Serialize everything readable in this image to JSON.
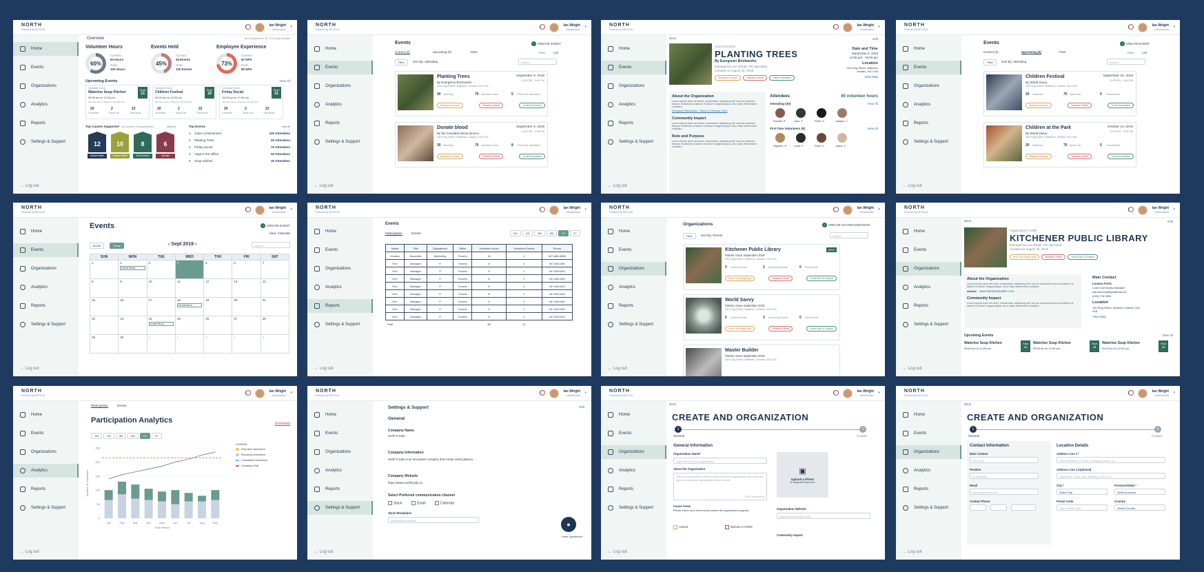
{
  "brand": {
    "logo": "NORTH",
    "sub": "Powered by NFOCUS"
  },
  "user": {
    "name": "Ian Wright",
    "role": "Administrator"
  },
  "nav": {
    "home": "Home",
    "events": "Events",
    "organizations": "Organizations",
    "analytics": "Analytics",
    "reports": "Reports",
    "settings": "Settings & Support",
    "logout": "Log out"
  },
  "common": {
    "back": "Back",
    "edit": "Edit",
    "view_all": "View All",
    "create_event": "CREATE EVENT",
    "filter": "Filter",
    "search": "Search",
    "upload_photo": "Upload a Photo",
    "upload_hint": "or Drag and Drop here"
  },
  "tags": {
    "marginal": "Marginal Groups",
    "disaster": "Disaster Relief",
    "youth": "Youth Education"
  },
  "dashboard": {
    "overview": "Overview",
    "as_of": "As of September 10, 2019 (last update)",
    "kpis": [
      {
        "title": "Volunteer Hours",
        "pct": "60%",
        "pct_label": "Achieved",
        "l1": "Current",
        "v1": "60 Hours",
        "l2": "Goal",
        "v2": "100 Hours",
        "color": "#6a7a8a"
      },
      {
        "title": "Events Held",
        "pct": "45%",
        "pct_label": "Achieved",
        "l1": "Current",
        "v1": "45 Events",
        "l2": "Goal",
        "v2": "100 Events",
        "color": "#c07a7a"
      },
      {
        "title": "Employee Experience",
        "pct": "73%",
        "pct_label": "Achieved",
        "l1": "Current",
        "v1": "62 NPS",
        "l2": "Goal",
        "v2": "85 NPS",
        "color": "#e06a5a"
      }
    ],
    "upcoming_title": "Upcoming Events",
    "upcoming": [
      {
        "type": "Volunteer Event",
        "name": "Waterloo Soup Kitchen",
        "time": "09:00 am to 12:00 pm",
        "addr": "150 King Street, Waterloo, ON N2L 3G1",
        "month": "Sept",
        "day": "13",
        "c1": "20",
        "c2": "2",
        "c3": "22"
      },
      {
        "type": "Volunteer Event",
        "name": "Children Festival",
        "time": "09:00 am to 12:00 pm",
        "addr": "150 King Street, Waterloo, ON N2L 3G1",
        "month": "Sept",
        "day": "18",
        "c1": "20",
        "c2": "2",
        "c3": "22"
      },
      {
        "type": "Corporate Event",
        "name": "Friday Social",
        "time": "15:00 pm to 17:00 pm",
        "addr": "150 King Street, Waterloo, ON N2L 3G1",
        "month": "Sept",
        "day": "21",
        "c1": "20",
        "c2": "2",
        "c3": "22"
      }
    ],
    "count_labels": [
      "Confirmed",
      "Spots Left",
      "Total Spots"
    ],
    "causes_title": "Top Causes Supported",
    "causes_sub": "(by Number of Organizations)",
    "causes": [
      {
        "n": "12",
        "label": "Mental Health",
        "color": "#243b5a"
      },
      {
        "n": "10",
        "label": "Disaster Relief",
        "color": "#9aa23a"
      },
      {
        "n": "8",
        "label": "Environment",
        "color": "#2f6a5a"
      },
      {
        "n": "6",
        "label": "Animals",
        "color": "#8a3b4b"
      }
    ],
    "top_events_title": "Top Events",
    "top_events": [
      {
        "name": "Junior Achievement",
        "v": "100 Attendees"
      },
      {
        "name": "Planting Trees",
        "v": "60 Attendees"
      },
      {
        "name": "Friday Social",
        "v": "70 Attendees"
      },
      {
        "name": "Yoga in the Office",
        "v": "50 Attendees"
      },
      {
        "name": "Soup Kitchen",
        "v": "40 Attendees"
      }
    ]
  },
  "events_list": {
    "title": "Events",
    "tabs": [
      "Current (2)",
      "Upcoming (0)",
      "Past"
    ],
    "sort": "Sort By: Attending",
    "view": "View:",
    "view_mode": "List",
    "items": [
      {
        "name": "Planting Trees",
        "by": "By Evergreen Brickworks",
        "addr": "150 King Street, Waterloo, Ontario, N2J 2X6",
        "date": "September 9, 2019",
        "time": "12:00 PM - 3:00 PM",
        "a": "30",
        "h": "70",
        "f": "5"
      },
      {
        "name": "Donate blood",
        "by": "By the Canadian blood service",
        "addr": "150 King Street, Waterloo, Ontario, N2J 2X6",
        "date": "September 9, 2019",
        "time": "12:00 PM - 3:00 PM",
        "a": "30",
        "h": "70",
        "f": "8"
      }
    ],
    "labels": [
      "Attending",
      "Volunteer hours",
      "First Time Volunteers"
    ]
  },
  "event_detail": {
    "current": "Current Events",
    "name": "PLANTING TREES",
    "by": "By Evergreen Brickworks",
    "managed": "Managed by Ian Wright, HR Specialist",
    "created": "Created on August 30, 2019",
    "date_label": "Date and Time",
    "date": "September 9, 2019",
    "time": "12:00 pm - 03:00 pm",
    "loc_label": "Location",
    "loc": "150 King Street, Waterloo Ontario, N2J 2X6",
    "map": "View Map",
    "about": "About the Organization",
    "lorem": "Lorem ipsum dolor sit amet, consectetur adipiscing elit, sed do eiusmod tempor incididunt ut labore et dolore magna aliqua. Arcu vitae elementum curabitur.",
    "waiver": "Evergreen Brickworks - Waiver & Release Form",
    "impact": "Community Impact",
    "role": "Role and Purpose",
    "attendees": "Attendees",
    "vol_hours": "60 volunteer hours",
    "attending": "Attending (30)",
    "first_time": "First time Volunteers (5)",
    "people": [
      "Rosalia. R",
      "Juan. P",
      "Peter. O",
      "Joaquin. C"
    ],
    "people2": [
      "Rigobert. R",
      "Luisa. P",
      "Peter. O",
      "Juana. C"
    ]
  },
  "events_upcoming": {
    "items": [
      {
        "name": "Children Festival",
        "by": "By World Savvy",
        "addr": "150 King Street, Waterloo, Ontario, N2J 2X6",
        "date": "September 18, 2019",
        "time": "12:00 PM - 3:00 PM",
        "a": "20",
        "h": "70",
        "f": "5"
      },
      {
        "name": "Children at the Park",
        "by": "By World Savvy",
        "addr": "150 King Street, Waterloo, Ontario, N2J 2X6",
        "date": "October 13, 2019",
        "time": "12:00 PM - 3:00 PM",
        "a": "20",
        "h": "70",
        "f": "5"
      }
    ],
    "labels": [
      "Confirmed",
      "Spots Left",
      "Unconfirmed"
    ]
  },
  "calendar": {
    "title": "Events",
    "month_btn": "Month",
    "today": "Today",
    "month": "Sept 2019",
    "view": "View: Calendar",
    "days": [
      "SUN",
      "MON",
      "TUE",
      "WED",
      "THU",
      "FRI",
      "SAT"
    ],
    "cells": [
      "1",
      "2",
      "3",
      "4",
      "5",
      "6",
      "7",
      "8",
      "9",
      "10",
      "11",
      "12",
      "13",
      "14",
      "15",
      "16",
      "17",
      "18",
      "19",
      "20",
      "21",
      "22",
      "23",
      "24",
      "25",
      "26",
      "27",
      "28",
      "29",
      "30",
      "1",
      "2",
      "3",
      "4",
      "5"
    ],
    "ev": "Donate Blood"
  },
  "report": {
    "title": "Events",
    "tabs": [
      "Participation",
      "Events"
    ],
    "ranges": [
      "1W",
      "1M",
      "3M",
      "6M",
      "1Y",
      "2Y"
    ],
    "headers": [
      "Name",
      "Title",
      "Department",
      "Office",
      "Volunteer Hours",
      "Volunteer Events",
      "Phone"
    ],
    "rows": [
      [
        "Jessica",
        "Associate",
        "Marketing",
        "Toronto",
        "16",
        "4",
        "647-888-8888"
      ],
      [
        "Erin",
        "Manager",
        "IT",
        "Toronto",
        "8",
        "2",
        "647-800-800"
      ],
      [
        "Erin",
        "Manager",
        "IT",
        "Toronto",
        "8",
        "2",
        "647-800-800"
      ],
      [
        "Erin",
        "Manager",
        "IT",
        "Toronto",
        "8",
        "2",
        "647-800-800"
      ],
      [
        "Erin",
        "Manager",
        "IT",
        "Toronto",
        "8",
        "2",
        "647-800-800"
      ],
      [
        "Erin",
        "Manager",
        "IT",
        "Toronto",
        "8",
        "2",
        "647-800-800"
      ],
      [
        "Erin",
        "Manager",
        "IT",
        "Toronto",
        "8",
        "2",
        "647-800-800"
      ],
      [
        "Erin",
        "Manager",
        "IT",
        "Toronto",
        "8",
        "2",
        "647-800-800"
      ],
      [
        "Erin",
        "Manager",
        "IT",
        "Toronto",
        "8",
        "2",
        "647-800-800"
      ]
    ],
    "total_label": "Total",
    "total_h": "88",
    "total_e": "14"
  },
  "orgs": {
    "title": "Organizations",
    "create": "CREATE AN ORGANIZATION",
    "sort": "Sort By: Recent",
    "items": [
      {
        "name": "Kitchener Public Library",
        "since": "Partner Since September 2019",
        "addr": "150 King Street, Waterloo, Ontario, N2J 2X6",
        "a": "0",
        "b": "2",
        "c": "0",
        "isnew": "NEW"
      },
      {
        "name": "World Savvy",
        "since": "Partner Since September 2019",
        "addr": "150 King Street, Waterloo, Ontario, N2J 2X6",
        "a": "0",
        "b": "2",
        "c": "0",
        "isnew": ""
      },
      {
        "name": "Master Builder",
        "since": "Partner Since September 2019",
        "addr": "150 King Street, Waterloo, Ontario, N2J 2X6",
        "a": "",
        "b": "",
        "c": "",
        "isnew": ""
      }
    ],
    "labels": [
      "Current Events",
      "Upcoming Events",
      "Past Events"
    ],
    "tags": [
      "Emp. for Marg Grps",
      "Disaster Relief",
      "Youth Edu & Dvlpmt"
    ]
  },
  "org_detail": {
    "profile": "Organization Profile",
    "name": "KITCHENER PUBLIC LIBRARY",
    "managed": "Managed by Ian Wright, HR Specialist",
    "created": "Created on August 30, 2019",
    "about": "About the Organization",
    "website_label": "website",
    "website": "www.kitchenerpublic.com",
    "impact": "Community Impact",
    "contact": "Main Contact",
    "contact_name": "Leanna Foris",
    "contact_role": "Lead Community Manager",
    "contact_email": "leanna.foris@kpublibrary.ca",
    "contact_phone": "(416) 278-0065",
    "loc_label": "Location",
    "loc": "150 King Street, Waterloo Ontario, N2J 2X6",
    "map": "View Map",
    "up": "Upcoming Events",
    "events": [
      {
        "name": "Waterloo Soup Kitchen",
        "time": "09:00 am to 12:00 pm",
        "m": "Sept",
        "d": "13"
      },
      {
        "name": "Waterloo Soup Kitchen",
        "time": "09:00 am to 12:00 pm",
        "m": "Sept",
        "d": "13"
      },
      {
        "name": "Waterloo Soup Kitchen",
        "time": "09:00 am to 12:00 pm",
        "m": "Sept",
        "d": "13"
      }
    ]
  },
  "analytics": {
    "tabs": [
      "Participation",
      "Events"
    ],
    "title": "Participation Analytics",
    "download": "Download",
    "ranges": [
      "1W",
      "1M",
      "3M",
      "6M",
      "1Y",
      "2Y"
    ],
    "legend_title": "LEGEND",
    "legend": [
      "First-time Volunteers",
      "Recurring Volunteers",
      "Cumulative Volunteers",
      "Company Goal"
    ],
    "ylabel": "Number of Volunteers",
    "xlabel": "Time Period",
    "yticks": [
      "0",
      "50",
      "100",
      "150",
      "200",
      "250"
    ]
  },
  "chart_data": {
    "type": "bar",
    "categories": [
      "Jan",
      "Feb",
      "Mar",
      "Apr",
      "May",
      "Jun",
      "Jul",
      "Aug",
      "Sep"
    ],
    "series": [
      {
        "name": "First-time Volunteers",
        "values": [
          35,
          45,
          50,
          40,
          35,
          50,
          30,
          20,
          35
        ]
      },
      {
        "name": "Recurring Volunteers",
        "values": [
          100,
          130,
          120,
          105,
          95,
          100,
          90,
          80,
          100
        ]
      },
      {
        "name": "Cumulative Volunteers",
        "values": [
          140,
          155,
          165,
          175,
          185,
          200,
          210,
          225,
          235
        ]
      },
      {
        "name": "Company Goal",
        "values": [
          215,
          215,
          215,
          215,
          215,
          215,
          215,
          215,
          215
        ]
      }
    ],
    "xlabel": "Time Period",
    "ylabel": "Number of Volunteers",
    "ylim": [
      0,
      250
    ]
  },
  "settings": {
    "title": "Settings & Support",
    "general": "General",
    "cname_l": "Company Name",
    "cname": "North Focals",
    "cinfo_l": "Company Information",
    "cinfo": "North Focals is an innovative company that create smart glasses.",
    "cweb_l": "Company Website",
    "cweb": "https://www.northfocals.ca",
    "channel_l": "Select Preferred communication channel",
    "channels": [
      "Slack",
      "Email",
      "Calendar"
    ],
    "slack_l": "Slack Workplace",
    "slack_ph": "Byouthfied Academy",
    "help": "Have Questions?"
  },
  "create_org": {
    "title": "CREATE AND ORGANIZATION",
    "step1": "General",
    "step2": "Contact",
    "gen_info": "General Information",
    "org_name_l": "Organization Name*",
    "org_name_ph": "Type name of the Organization",
    "about_l": "About the Organization",
    "about_ph": "Tell your employees a little bit about what the organization does and the types of volunteer opportunities they provide.",
    "chars": "2,000 characters",
    "cause_l": "Cause Areas",
    "cause_hint": "Please select up to three social causes the organization supports.",
    "cause1": "Animal",
    "cause2": "Women in STEM",
    "web_l": "Organization Website",
    "web_ph": "https://www.example.com",
    "impact_l": "Community Impact"
  },
  "create_org2": {
    "contact_info": "Contact Information",
    "loc_details": "Location Details",
    "main_contact": "Main Contact",
    "main_ph": "John Doe",
    "position": "Position",
    "position_ph": "Hr Manager",
    "email": "Email",
    "email_ph": "johndoe@email.com",
    "phone": "Contact Phone",
    "addr1": "Address Line 1 *",
    "addr1_ph": "Street Address, P.O.Box, Company name, c/o",
    "addr2": "Address Line 2 (optional)",
    "addr2_ph": "Apartment, Suite, Unit, Building, Floor, ETC.",
    "city": "City *",
    "city_ph": "Select City",
    "prov": "Province/State *",
    "prov_ph": "Select province",
    "postal": "Postal Code",
    "postal_ph": "Type Postal Code",
    "country": "Country",
    "country_ph": "Select Country"
  }
}
